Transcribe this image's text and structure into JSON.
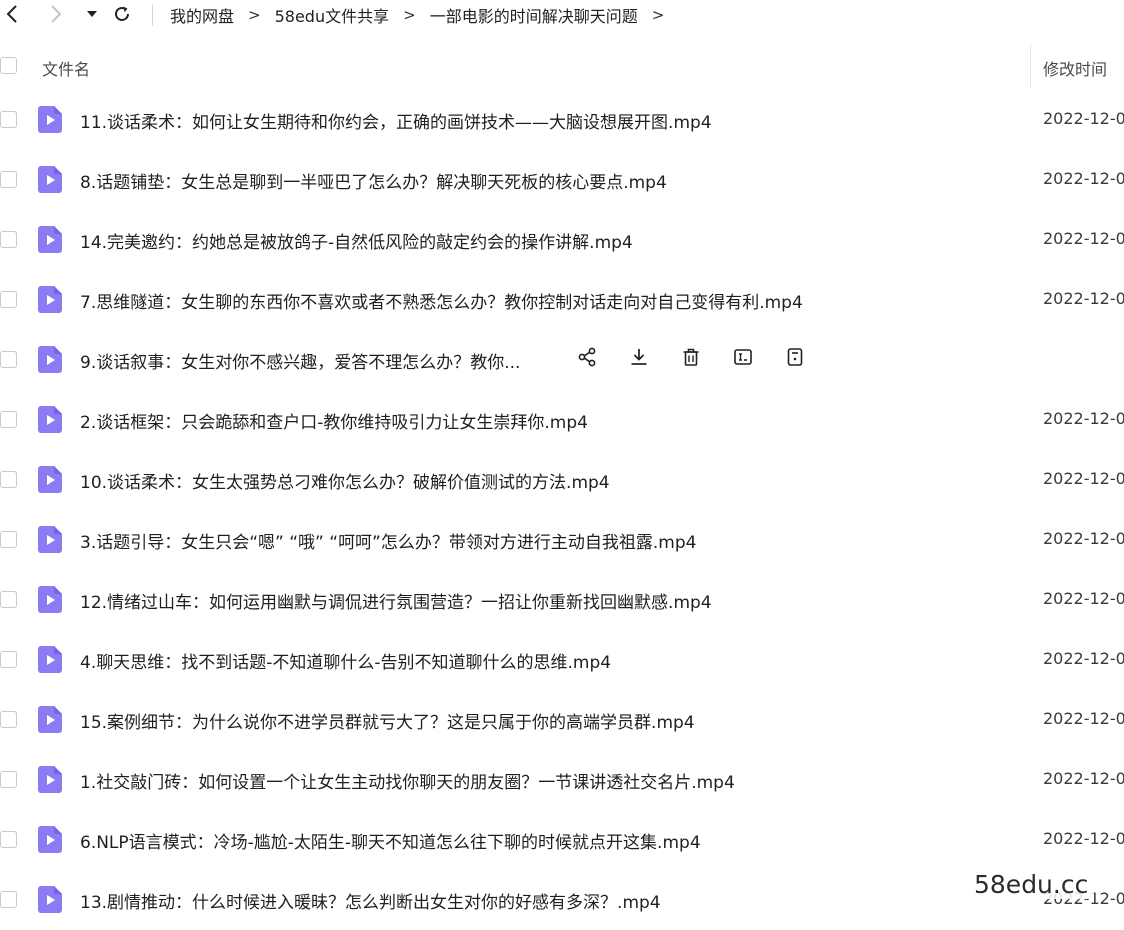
{
  "breadcrumbs": [
    "我的网盘",
    "58edu文件共享",
    "一部电影的时间解决聊天问题"
  ],
  "breadcrumb_separator": ">",
  "columns": {
    "name": "文件名",
    "mtime": "修改时间"
  },
  "files": [
    {
      "name": "11.谈话柔术：如何让女生期待和你约会，正确的画饼技术——大脑设想展开图.mp4",
      "mtime": "2022-12-0"
    },
    {
      "name": "8.话题铺垫：女生总是聊到一半哑巴了怎么办？解决聊天死板的核心要点.mp4",
      "mtime": "2022-12-0"
    },
    {
      "name": "14.完美邀约：约她总是被放鸽子-自然低风险的敲定约会的操作讲解.mp4",
      "mtime": "2022-12-0"
    },
    {
      "name": "7.思维隧道：女生聊的东西你不喜欢或者不熟悉怎么办？教你控制对话走向对自己变得有利.mp4",
      "mtime": "2022-12-0"
    },
    {
      "name": "9.谈话叙事：女生对你不感兴趣，爱答不理怎么办？教你...",
      "mtime": "",
      "hovered": true
    },
    {
      "name": "2.谈话框架：只会跪舔和查户口-教你维持吸引力让女生崇拜你.mp4",
      "mtime": "2022-12-0"
    },
    {
      "name": "10.谈话柔术：女生太强势总刁难你怎么办？破解价值测试的方法.mp4",
      "mtime": "2022-12-0"
    },
    {
      "name": "3.话题引导：女生只会“嗯” “哦” “呵呵”怎么办？带领对方进行主动自我祖露.mp4",
      "mtime": "2022-12-0"
    },
    {
      "name": "12.情绪过山车：如何运用幽默与调侃进行氛围营造？一招让你重新找回幽默感.mp4",
      "mtime": "2022-12-0"
    },
    {
      "name": "4.聊天思维：找不到话题-不知道聊什么-告别不知道聊什么的思维.mp4",
      "mtime": "2022-12-0"
    },
    {
      "name": "15.案例细节：为什么说你不进学员群就亏大了？这是只属于你的高端学员群.mp4",
      "mtime": "2022-12-0"
    },
    {
      "name": "1.社交敲门砖：如何设置一个让女生主动找你聊天的朋友圈？一节课讲透社交名片.mp4",
      "mtime": "2022-12-0"
    },
    {
      "name": "6.NLP语言模式：冷场-尴尬-太陌生-聊天不知道怎么往下聊的时候就点开这集.mp4",
      "mtime": "2022-12-0"
    },
    {
      "name": "13.剧情推动：什么时候进入暖昧？怎么判断出女生对你的好感有多深？.mp4",
      "mtime": "2022-12-0"
    }
  ],
  "hover_actions": [
    "share-icon",
    "download-icon",
    "delete-icon",
    "rename-icon",
    "more-icon"
  ],
  "watermark": "58edu.cc",
  "colors": {
    "file_icon": "#8b7cf6",
    "file_icon_dark": "#7465e8"
  }
}
